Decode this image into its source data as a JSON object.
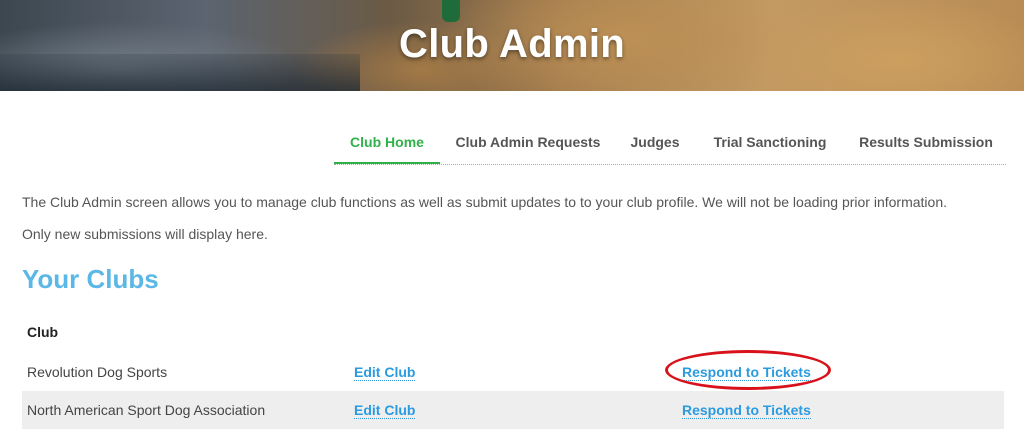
{
  "header": {
    "title": "Club Admin"
  },
  "tabs": [
    {
      "label": "Club Home",
      "active": true
    },
    {
      "label": "Club Admin Requests",
      "active": false
    },
    {
      "label": "Judges",
      "active": false
    },
    {
      "label": "Trial Sanctioning",
      "active": false
    },
    {
      "label": "Results Submission",
      "active": false
    }
  ],
  "intro": {
    "line1": "The Club Admin screen allows you to manage club functions as well as submit updates to to your club profile.  We will not be loading prior information.",
    "line2": "Only new submissions will display here."
  },
  "clubs": {
    "title": "Your Clubs",
    "column_header": "Club",
    "rows": [
      {
        "name": "Revolution Dog Sports",
        "edit_label": "Edit Club",
        "tickets_label": "Respond to Tickets"
      },
      {
        "name": "North American Sport Dog Association",
        "edit_label": "Edit Club",
        "tickets_label": "Respond to Tickets"
      }
    ]
  },
  "colors": {
    "active_tab": "#2fb24a",
    "section_title": "#5bb8e6",
    "link": "#2b9be0",
    "annotation_oval": "#d8111b"
  }
}
